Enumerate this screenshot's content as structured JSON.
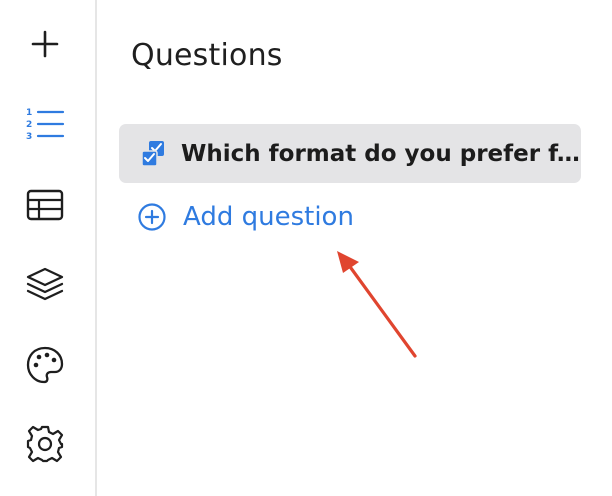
{
  "rail": {
    "items": [
      {
        "icon": "plus-icon"
      },
      {
        "icon": "numbered-list-icon",
        "active": true
      },
      {
        "icon": "table-icon"
      },
      {
        "icon": "layers-icon"
      },
      {
        "icon": "palette-icon"
      },
      {
        "icon": "gear-icon"
      }
    ]
  },
  "panel": {
    "title": "Questions",
    "questions": [
      {
        "text": "Which format do you prefer f...",
        "icon": "checkbox-question-icon"
      }
    ],
    "add_question_label": "Add question"
  },
  "colors": {
    "accent": "#2f7be0",
    "arrow": "#e0452f",
    "selected_bg": "#e4e4e6"
  }
}
